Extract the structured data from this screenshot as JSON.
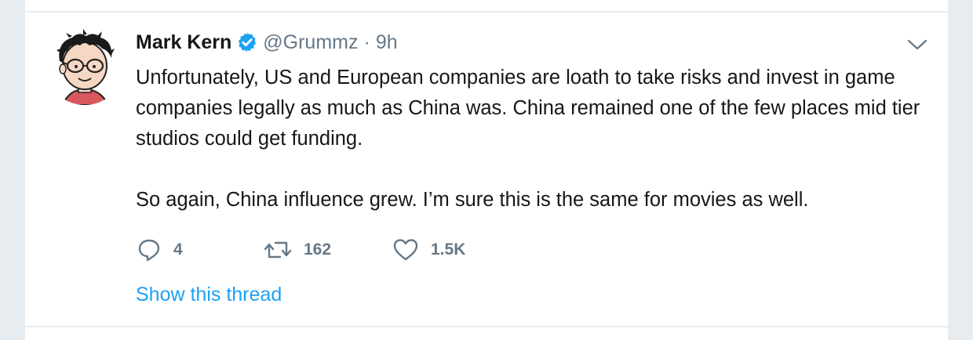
{
  "tweet": {
    "author_name": "Mark Kern",
    "author_handle": "@Grummz",
    "separator": "·",
    "time_ago": "9h",
    "text_paragraphs": [
      "Unfortunately, US and European companies are loath to take risks and invest in game companies legally as much as China was. China remained one of the few places mid tier studios could get funding.",
      "So again, China influence grew. I’m sure this is the same for movies as well."
    ],
    "verified": true,
    "avatar_icon": "cartoon-avatar"
  },
  "actions": {
    "reply": {
      "icon": "reply-icon",
      "count": "4"
    },
    "retweet": {
      "icon": "retweet-icon",
      "count": "162"
    },
    "like": {
      "icon": "heart-icon",
      "count": "1.5K"
    }
  },
  "show_thread_label": "Show this thread",
  "colors": {
    "background": "#e6ecf0",
    "card": "#ffffff",
    "text": "#14171a",
    "muted": "#657786",
    "link": "#1da1f2",
    "verified": "#1da1f2",
    "avatar_shirt": "#d9575f"
  }
}
